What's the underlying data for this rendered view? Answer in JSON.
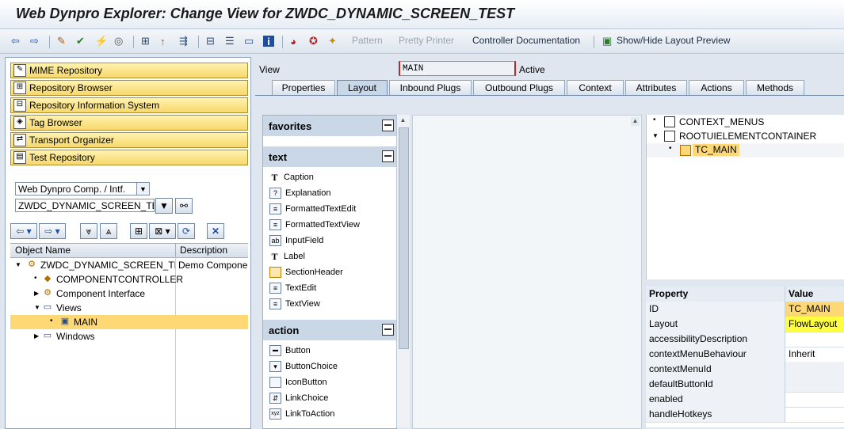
{
  "title": "Web Dynpro Explorer: Change View for ZWDC_DYNAMIC_SCREEN_TEST",
  "toolbar": {
    "icons": [
      "back-arrow-icon",
      "forward-arrow-icon",
      "edit-pencil-icon",
      "check-icon",
      "activate-icon",
      "where-used-icon",
      "hierarchy-icon",
      "up-icon",
      "move-icon",
      "tree-icon",
      "stack-icon",
      "display-icon",
      "info-icon",
      "other-object-icon",
      "help-icon",
      "wizard-icon"
    ],
    "pattern": "Pattern",
    "pretty_printer": "Pretty Printer",
    "controller_doc": "Controller Documentation",
    "show_hide": "Show/Hide Layout Preview"
  },
  "nav": [
    {
      "label": "MIME Repository",
      "icon": "mime-icon"
    },
    {
      "label": "Repository Browser",
      "icon": "browser-icon"
    },
    {
      "label": "Repository Information System",
      "icon": "info-system-icon"
    },
    {
      "label": "Tag Browser",
      "icon": "tag-icon"
    },
    {
      "label": "Transport Organizer",
      "icon": "transport-icon"
    },
    {
      "label": "Test Repository",
      "icon": "test-icon"
    }
  ],
  "object_type": "Web Dynpro Comp. / Intf.",
  "object_name": "ZWDC_DYNAMIC_SCREEN_TEST",
  "tree": {
    "col_name": "Object Name",
    "col_desc": "Description",
    "rows": [
      {
        "label": "ZWDC_DYNAMIC_SCREEN_TEST",
        "desc": "Demo Component"
      },
      {
        "label": "COMPONENTCONTROLLER",
        "desc": ""
      },
      {
        "label": "Component Interface",
        "desc": ""
      },
      {
        "label": "Views",
        "desc": ""
      },
      {
        "label": "MAIN",
        "desc": ""
      },
      {
        "label": "Windows",
        "desc": ""
      }
    ]
  },
  "view": {
    "label": "View",
    "value": "MAIN",
    "status": "Active"
  },
  "tabs": [
    "Properties",
    "Layout",
    "Inbound Plugs",
    "Outbound Plugs",
    "Context",
    "Attributes",
    "Actions",
    "Methods"
  ],
  "palette": {
    "sections": [
      "favorites",
      "text",
      "action"
    ],
    "text_items": [
      "Caption",
      "Explanation",
      "FormattedTextEdit",
      "FormattedTextView",
      "InputField",
      "Label",
      "SectionHeader",
      "TextEdit",
      "TextView"
    ],
    "action_items": [
      "Button",
      "ButtonChoice",
      "IconButton",
      "LinkChoice",
      "LinkToAction"
    ]
  },
  "ui_tree": [
    "CONTEXT_MENUS",
    "ROOTUIELEMENTCONTAINER",
    "TC_MAIN"
  ],
  "properties": {
    "col_prop": "Property",
    "col_val": "Value",
    "rows": [
      {
        "k": "ID",
        "v": "TC_MAIN"
      },
      {
        "k": "Layout",
        "v": "FlowLayout"
      },
      {
        "k": "accessibilityDescription",
        "v": ""
      },
      {
        "k": "contextMenuBehaviour",
        "v": "Inherit"
      },
      {
        "k": "contextMenuId",
        "v": ""
      },
      {
        "k": "defaultButtonId",
        "v": ""
      },
      {
        "k": "enabled",
        "v": ""
      },
      {
        "k": "handleHotkeys",
        "v": ""
      }
    ]
  },
  "colors": {
    "accent": "#f7d86a",
    "selected_row": "#fdd874",
    "highlight": "#ffff40"
  }
}
